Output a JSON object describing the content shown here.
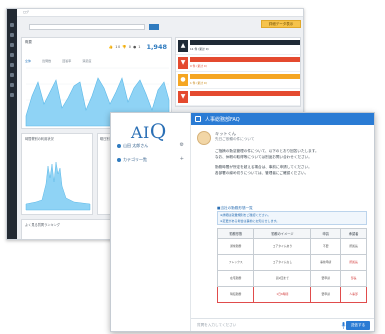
{
  "dashboard": {
    "topbar_text": "ログ",
    "export_label": "詳細データ表示",
    "panel_main_title": "概要",
    "tabs": [
      "全体",
      "質問数",
      "回答率",
      "満足度"
    ],
    "kpi_icons": "👍 10 👎 0 ● 1",
    "kpi_value": "1,948",
    "feed_items": [
      {
        "color": "#1f2a36",
        "icon": "👍",
        "sub": "11 件 (累計 0)"
      },
      {
        "color": "#e44a2f",
        "icon": "👎",
        "sub": "0 件 (累計 0)"
      },
      {
        "color": "#f5a623",
        "icon": "●",
        "sub": "1 件 (累計 0)"
      }
    ],
    "mini_title_left": "時間帯別の利用状況",
    "mini_title_right": "曜日別",
    "ranking_title": "よく見る質問ランキング",
    "chart_colors": {
      "area": "#8fd3f5",
      "area_stroke": "#5db9e8"
    }
  },
  "chat": {
    "header_title": "人事総務部FAQ",
    "logo": "AIQ",
    "sidebar": [
      {
        "label": "山田 太郎さん"
      },
      {
        "label": "カテゴリ一覧"
      }
    ],
    "bot_name": "キットくん",
    "bot_sub": "先日ご依頼の件について",
    "messages": [
      "ご指摘の勤怠管理の件について、以下のとおり回答いたします。",
      "なお、休暇の取得等については別途お問い合わせください。",
      "勤務時間が所定を超える場合は、事前に申請してください。",
      "各部署の締め切りについては、管理者にご確認ください。"
    ],
    "note_title": "■当社の勤務形態一覧",
    "note_lines": [
      "※詳細は就業規則をご確認ください。",
      "※変更がある場合は事前にお知らせします。"
    ],
    "table_headers": [
      "勤務形態",
      "勤務のイメージ",
      "申請",
      "承認者"
    ],
    "table_rows": [
      [
        "通常勤務",
        "コアタイムあり",
        "不要",
        "所属長"
      ],
      [
        "フレックス",
        "コアタイムなし",
        "事前申請",
        "所属長"
      ],
      [
        "在宅勤務",
        "週2回まで",
        "要申請",
        "部長"
      ],
      [
        "時短勤務",
        "1日6時間",
        "要申請",
        "人事部"
      ]
    ],
    "input_placeholder": "質問を入力してください",
    "send_label": "送信する"
  }
}
